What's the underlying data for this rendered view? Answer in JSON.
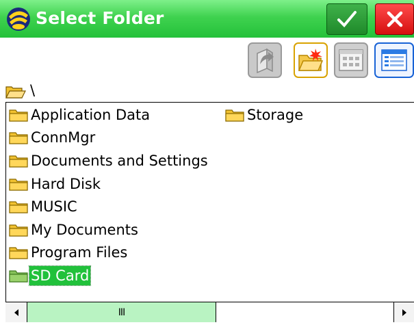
{
  "window": {
    "title": "Select Folder"
  },
  "titlebar": {
    "app_icon": "app-logo-icon",
    "ok_icon": "checkmark-icon",
    "cancel_icon": "close-icon",
    "colors": {
      "bar": "#2fc944",
      "ok": "#1f8a2a",
      "cancel": "#d50f0f"
    }
  },
  "toolbar": {
    "buttons": [
      {
        "name": "up-folder-button",
        "icon": "up-folder-icon"
      },
      {
        "name": "new-folder-button",
        "icon": "new-folder-icon"
      },
      {
        "name": "icon-view-button",
        "icon": "grid-view-icon"
      },
      {
        "name": "details-view-button",
        "icon": "list-view-icon"
      }
    ]
  },
  "path": {
    "current": "\\"
  },
  "folders": [
    {
      "label": "Application Data",
      "selected": false
    },
    {
      "label": "ConnMgr",
      "selected": false
    },
    {
      "label": "Documents and Settings",
      "selected": false
    },
    {
      "label": "Hard Disk",
      "selected": false
    },
    {
      "label": "MUSIC",
      "selected": false
    },
    {
      "label": "My Documents",
      "selected": false
    },
    {
      "label": "Program Files",
      "selected": false
    },
    {
      "label": "SD Card",
      "selected": true
    },
    {
      "label": "Storage",
      "selected": false
    }
  ],
  "scrollbar": {
    "grip": "III",
    "position": 0.0
  },
  "colors": {
    "selection": "#21c13b",
    "folder": "#f2c230"
  }
}
